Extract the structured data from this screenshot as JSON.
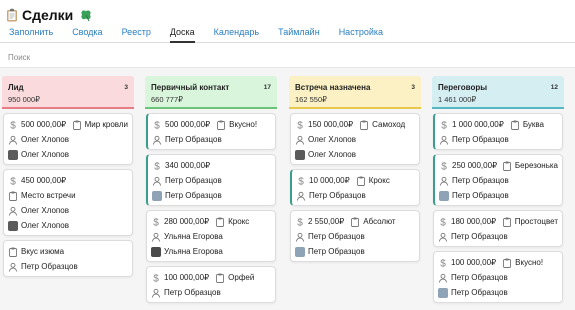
{
  "app": {
    "title": "Сделки"
  },
  "tabs": [
    "Заполнить",
    "Сводка",
    "Реестр",
    "Доска",
    "Календарь",
    "Таймлайн",
    "Настройка"
  ],
  "active_tab": "Доска",
  "search": {
    "placeholder": "Поиск"
  },
  "columns": [
    {
      "title": "Лид",
      "sum": "950 000₽",
      "count": "3",
      "color": "#fadadd",
      "border": "#e87c86",
      "cards": [
        {
          "amount": "500 000,00₽",
          "tag": "Мир кровли",
          "contact": "Олег Хлопов",
          "owner": "Олег Хлопов",
          "avatar": "dark"
        },
        {
          "amount": "450 000,00₽",
          "tag": "Место встречи",
          "contact": "Олег Хлопов",
          "owner": "Олег Хлопов",
          "avatar": "dark",
          "tag_newline": true
        },
        {
          "tag": "Вкус изюма",
          "owner_person": "Петр Образцов"
        }
      ]
    },
    {
      "title": "Первичный контакт",
      "sum": "660 777₽",
      "count": "17",
      "color": "#d9f5dc",
      "border": "#6cc47a",
      "cards": [
        {
          "amount": "500 000,00₽",
          "tag": "Вкусно!",
          "owner_person": "Петр Образцов",
          "accent": true
        },
        {
          "amount": "340 000,00₽",
          "contact": "Петр Образцов",
          "owner": "Петр Образцов",
          "avatar": "light",
          "accent": true
        },
        {
          "amount": "280 000,00₽",
          "tag": "Крокс",
          "contact": "Ульяна Егорова",
          "owner": "Ульяна Егорова",
          "avatar": "dark2"
        },
        {
          "amount": "100 000,00₽",
          "tag": "Орфей",
          "contact": "Петр Образцов"
        }
      ]
    },
    {
      "title": "Встреча назначена",
      "sum": "162 550₽",
      "count": "3",
      "color": "#fbf1c4",
      "border": "#e5c84c",
      "cards": [
        {
          "amount": "150 000,00₽",
          "tag": "Самоход",
          "contact": "Олег Хлопов",
          "owner": "Олег Хлопов",
          "avatar": "dark"
        },
        {
          "amount": "10 000,00₽",
          "tag": "Крокс",
          "owner_person": "Петр Образцов",
          "accent": true
        },
        {
          "amount": "2 550,00₽",
          "tag": "Абсолют",
          "contact": "Петр Образцов",
          "owner": "Петр Образцов",
          "avatar": "light"
        }
      ]
    },
    {
      "title": "Переговоры",
      "sum": "1 461 000₽",
      "count": "12",
      "color": "#d4eef2",
      "border": "#57b6c4",
      "cards": [
        {
          "amount": "1 000 000,00₽",
          "tag": "Буква",
          "owner_person": "Петр Образцов",
          "accent": true
        },
        {
          "amount": "250 000,00₽",
          "tag": "Березонька",
          "contact": "Петр Образцов",
          "owner": "Петр Образцов",
          "avatar": "light",
          "accent": true
        },
        {
          "amount": "180 000,00₽",
          "tag": "Простоцвет",
          "contact": "Петр Образцов"
        },
        {
          "amount": "100 000,00₽",
          "tag": "Вкусно!",
          "contact": "Петр Образцов",
          "owner": "Петр Образцов",
          "avatar": "light"
        }
      ]
    }
  ]
}
